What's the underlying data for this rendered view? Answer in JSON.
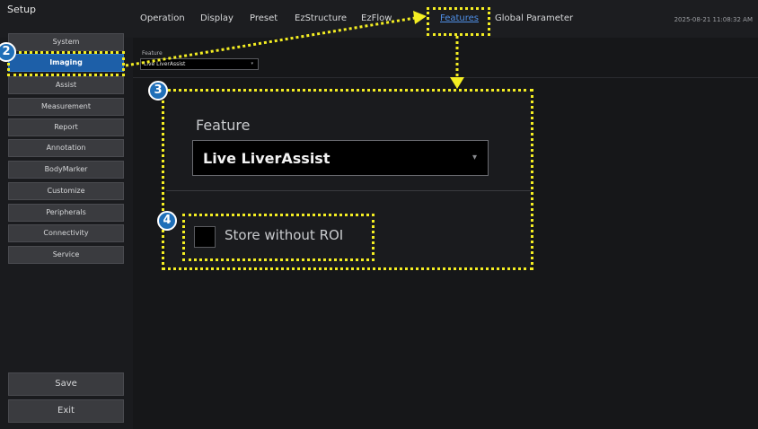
{
  "window": {
    "title": "Setup"
  },
  "tabs": [
    {
      "label": "Operation"
    },
    {
      "label": "Display"
    },
    {
      "label": "Preset"
    },
    {
      "label": "EzStructure"
    },
    {
      "label": "EzFlow"
    },
    {
      "label": "Features"
    },
    {
      "label": "Global Parameter"
    }
  ],
  "active_tab": "Features",
  "timestamp": "2025-08-21 11:08:32 AM",
  "sidebar": {
    "items": [
      {
        "label": "System"
      },
      {
        "label": "Imaging"
      },
      {
        "label": "Assist"
      },
      {
        "label": "Measurement"
      },
      {
        "label": "Report"
      },
      {
        "label": "Annotation"
      },
      {
        "label": "BodyMarker"
      },
      {
        "label": "Customize"
      },
      {
        "label": "Peripherals"
      },
      {
        "label": "Connectivity"
      },
      {
        "label": "Service"
      }
    ],
    "active": "Imaging",
    "save_label": "Save",
    "exit_label": "Exit"
  },
  "feature": {
    "label": "Feature",
    "selected": "Live LiverAssist",
    "dropdown_arrow": "▾"
  },
  "store_without_roi": {
    "label": "Store without ROI",
    "checked": false
  },
  "callouts": {
    "badge_2": "2",
    "badge_3": "3",
    "badge_4": "4"
  },
  "colors": {
    "highlight": "#f4ee22",
    "accent": "#1d5fa8",
    "active_tab": "#4f8fe6",
    "badge": "#1f6fb8"
  }
}
